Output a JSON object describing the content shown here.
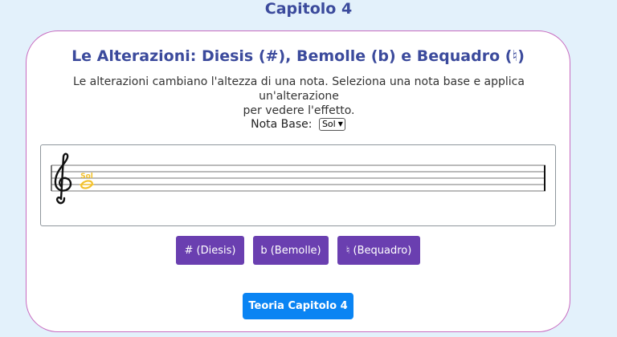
{
  "header": {
    "chapter_title": "Capitolo 4"
  },
  "card": {
    "title": "Le Alterazioni: Diesis (#), Bemolle (b) e Bequadro (♮)",
    "description_line1": "Le alterazioni cambiano l'altezza di una nota. Seleziona una nota base e applica un'alterazione",
    "description_line2": "per vedere l'effetto.",
    "note_base_label": "Nota Base:",
    "note_select_value": "Sol",
    "staff": {
      "clef_icon": "treble-clef-icon",
      "note_label": "Sol",
      "note_color": "#f2c12e"
    },
    "buttons": {
      "sharp_label": "# (Diesis)",
      "flat_label": "b (Bemolle)",
      "natural_label": "♮ (Bequadro)"
    },
    "theory_button_label": "Teoria Capitolo 4"
  },
  "colors": {
    "accent_title": "#3b4a9c",
    "card_border": "#c86bc0",
    "accidental_button": "#6a3fb0",
    "theory_button": "#0a84f3",
    "background": "#e3f1fb"
  }
}
